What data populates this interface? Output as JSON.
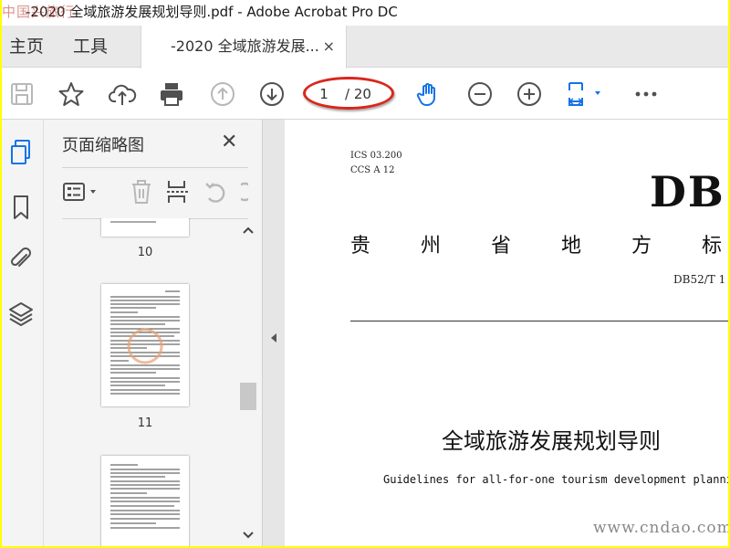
{
  "window": {
    "title": "-2020 全域旅游发展规划导则.pdf - Adobe Acrobat Pro DC",
    "overlay_watermark": "中国兴旅行"
  },
  "tabs": {
    "home": "主页",
    "tools": "工具",
    "document": "-2020 全域旅游发展...",
    "close_symbol": "×"
  },
  "toolbar": {
    "current_page": "1",
    "total_pages": "/ 20",
    "icons": [
      "save-icon",
      "star-icon",
      "cloud-upload-icon",
      "print-icon",
      "page-up-icon",
      "page-down-icon",
      "hand-tool-icon",
      "zoom-out-icon",
      "zoom-in-icon",
      "fit-page-icon",
      "more-icon"
    ]
  },
  "rail": {
    "icons": [
      "page-thumbnails-icon",
      "bookmark-icon",
      "attachment-icon",
      "layers-icon"
    ]
  },
  "thumbnail_panel": {
    "title": "页面缩略图",
    "close_symbol": "✕",
    "pages": [
      {
        "label": "10"
      },
      {
        "label": "11"
      }
    ]
  },
  "document": {
    "ics": "ICS 03.200",
    "ccs": "CCS A 12",
    "standard_code": "DB",
    "province_title_chars": [
      "贵",
      "州",
      "省",
      "地",
      "方",
      "标"
    ],
    "standard_number": "DB52/T 1",
    "title_cn": "全域旅游发展规划导则",
    "title_en": "Guidelines for all-for-one tourism development planni"
  },
  "watermark": "www.cndao.com",
  "colors": {
    "frame": "#ffff00",
    "accent_blue": "#1473e6",
    "highlight_red": "#d9261c"
  }
}
